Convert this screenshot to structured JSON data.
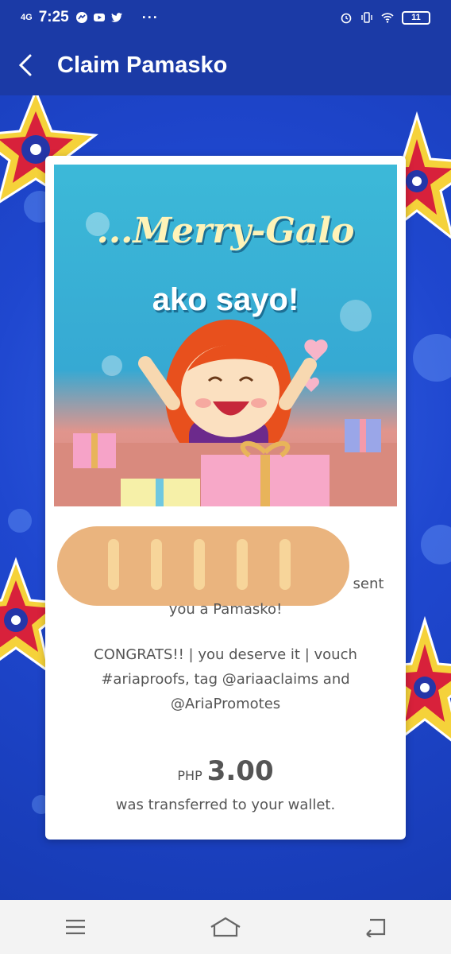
{
  "status_bar": {
    "network": "4G",
    "time": "7:25",
    "battery": "11"
  },
  "header": {
    "title": "Claim Pamasko"
  },
  "promo": {
    "headline": "...Merry-Galo",
    "subhead": "ako sayo!"
  },
  "claim": {
    "sent_suffix": "sent",
    "sent_line2": "you a Pamasko!",
    "message": "CONGRATS!! | you deserve it | vouch #ariaproofs, tag @ariaaclaims and @AriaPromotes",
    "currency": "PHP",
    "amount": "3.00",
    "transfer_note": "was transferred to your wallet."
  },
  "colors": {
    "header_bg": "#1b3aa6",
    "page_bg": "#1a40c4",
    "card_bg": "#ffffff"
  }
}
